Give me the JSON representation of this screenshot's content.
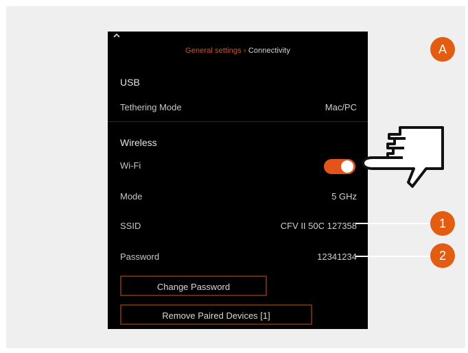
{
  "header": {
    "crumb": "General settings",
    "separator": "›",
    "current": "Connectivity"
  },
  "usb": {
    "title": "USB",
    "tethering_label": "Tethering Mode",
    "tethering_value": "Mac/PC"
  },
  "wireless": {
    "title": "Wireless",
    "wifi_label": "Wi-Fi",
    "wifi_on": true,
    "mode_label": "Mode",
    "mode_value": "5 GHz",
    "ssid_label": "SSID",
    "ssid_value": "CFV II 50C 127358",
    "password_label": "Password",
    "password_value": "12341234"
  },
  "buttons": {
    "change_password": "Change Password",
    "remove_paired": "Remove Paired Devices [1]"
  },
  "callouts": {
    "a": "A",
    "one": "1",
    "two": "2"
  },
  "colors": {
    "accent": "#e2541a",
    "badge": "#e25c12",
    "screen_bg": "#000000",
    "frame_bg": "#efefef"
  },
  "icons": {
    "back": "back-arrow-icon",
    "hand": "pointing-hand-icon"
  }
}
